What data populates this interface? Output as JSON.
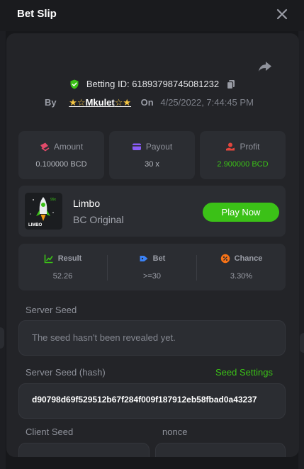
{
  "header": {
    "title": "Bet Slip"
  },
  "bet": {
    "id_label": "Betting ID: 61893798745081232",
    "by_label": "By",
    "user_star_left": "★☆",
    "user_name": "Mkulet",
    "user_star_right": "☆★",
    "on_label": "On",
    "datetime": "4/25/2022, 7:44:45 PM"
  },
  "stats": [
    {
      "label": "Amount",
      "value": "0.100000 BCD",
      "icon": "amount-icon"
    },
    {
      "label": "Payout",
      "value": "30 x",
      "icon": "wallet-icon"
    },
    {
      "label": "Profit",
      "value": "2.900000 BCD",
      "icon": "profit-icon"
    }
  ],
  "game": {
    "name": "Limbo",
    "subtitle": "BC Original",
    "play_label": "Play Now",
    "thumb_text": "LIMBO",
    "thumb_badge": "99x"
  },
  "results": [
    {
      "label": "Result",
      "value": "52.26",
      "icon": "chart-icon"
    },
    {
      "label": "Bet",
      "value": ">=30",
      "icon": "tag-icon"
    },
    {
      "label": "Chance",
      "value": "3.30%",
      "icon": "percent-icon"
    }
  ],
  "server_seed": {
    "label": "Server Seed",
    "text": "The seed hasn't been revealed yet."
  },
  "server_seed_hash": {
    "label": "Server Seed (hash)",
    "settings_label": "Seed Settings",
    "value": "d90798d69f529512b67f284f009f187912eb58fbad0a43237"
  },
  "client_seed": {
    "label": "Client Seed"
  },
  "nonce": {
    "label": "nonce"
  },
  "colors": {
    "accent": "#3bc117",
    "panel": "#232428",
    "card": "#2b2d32"
  }
}
